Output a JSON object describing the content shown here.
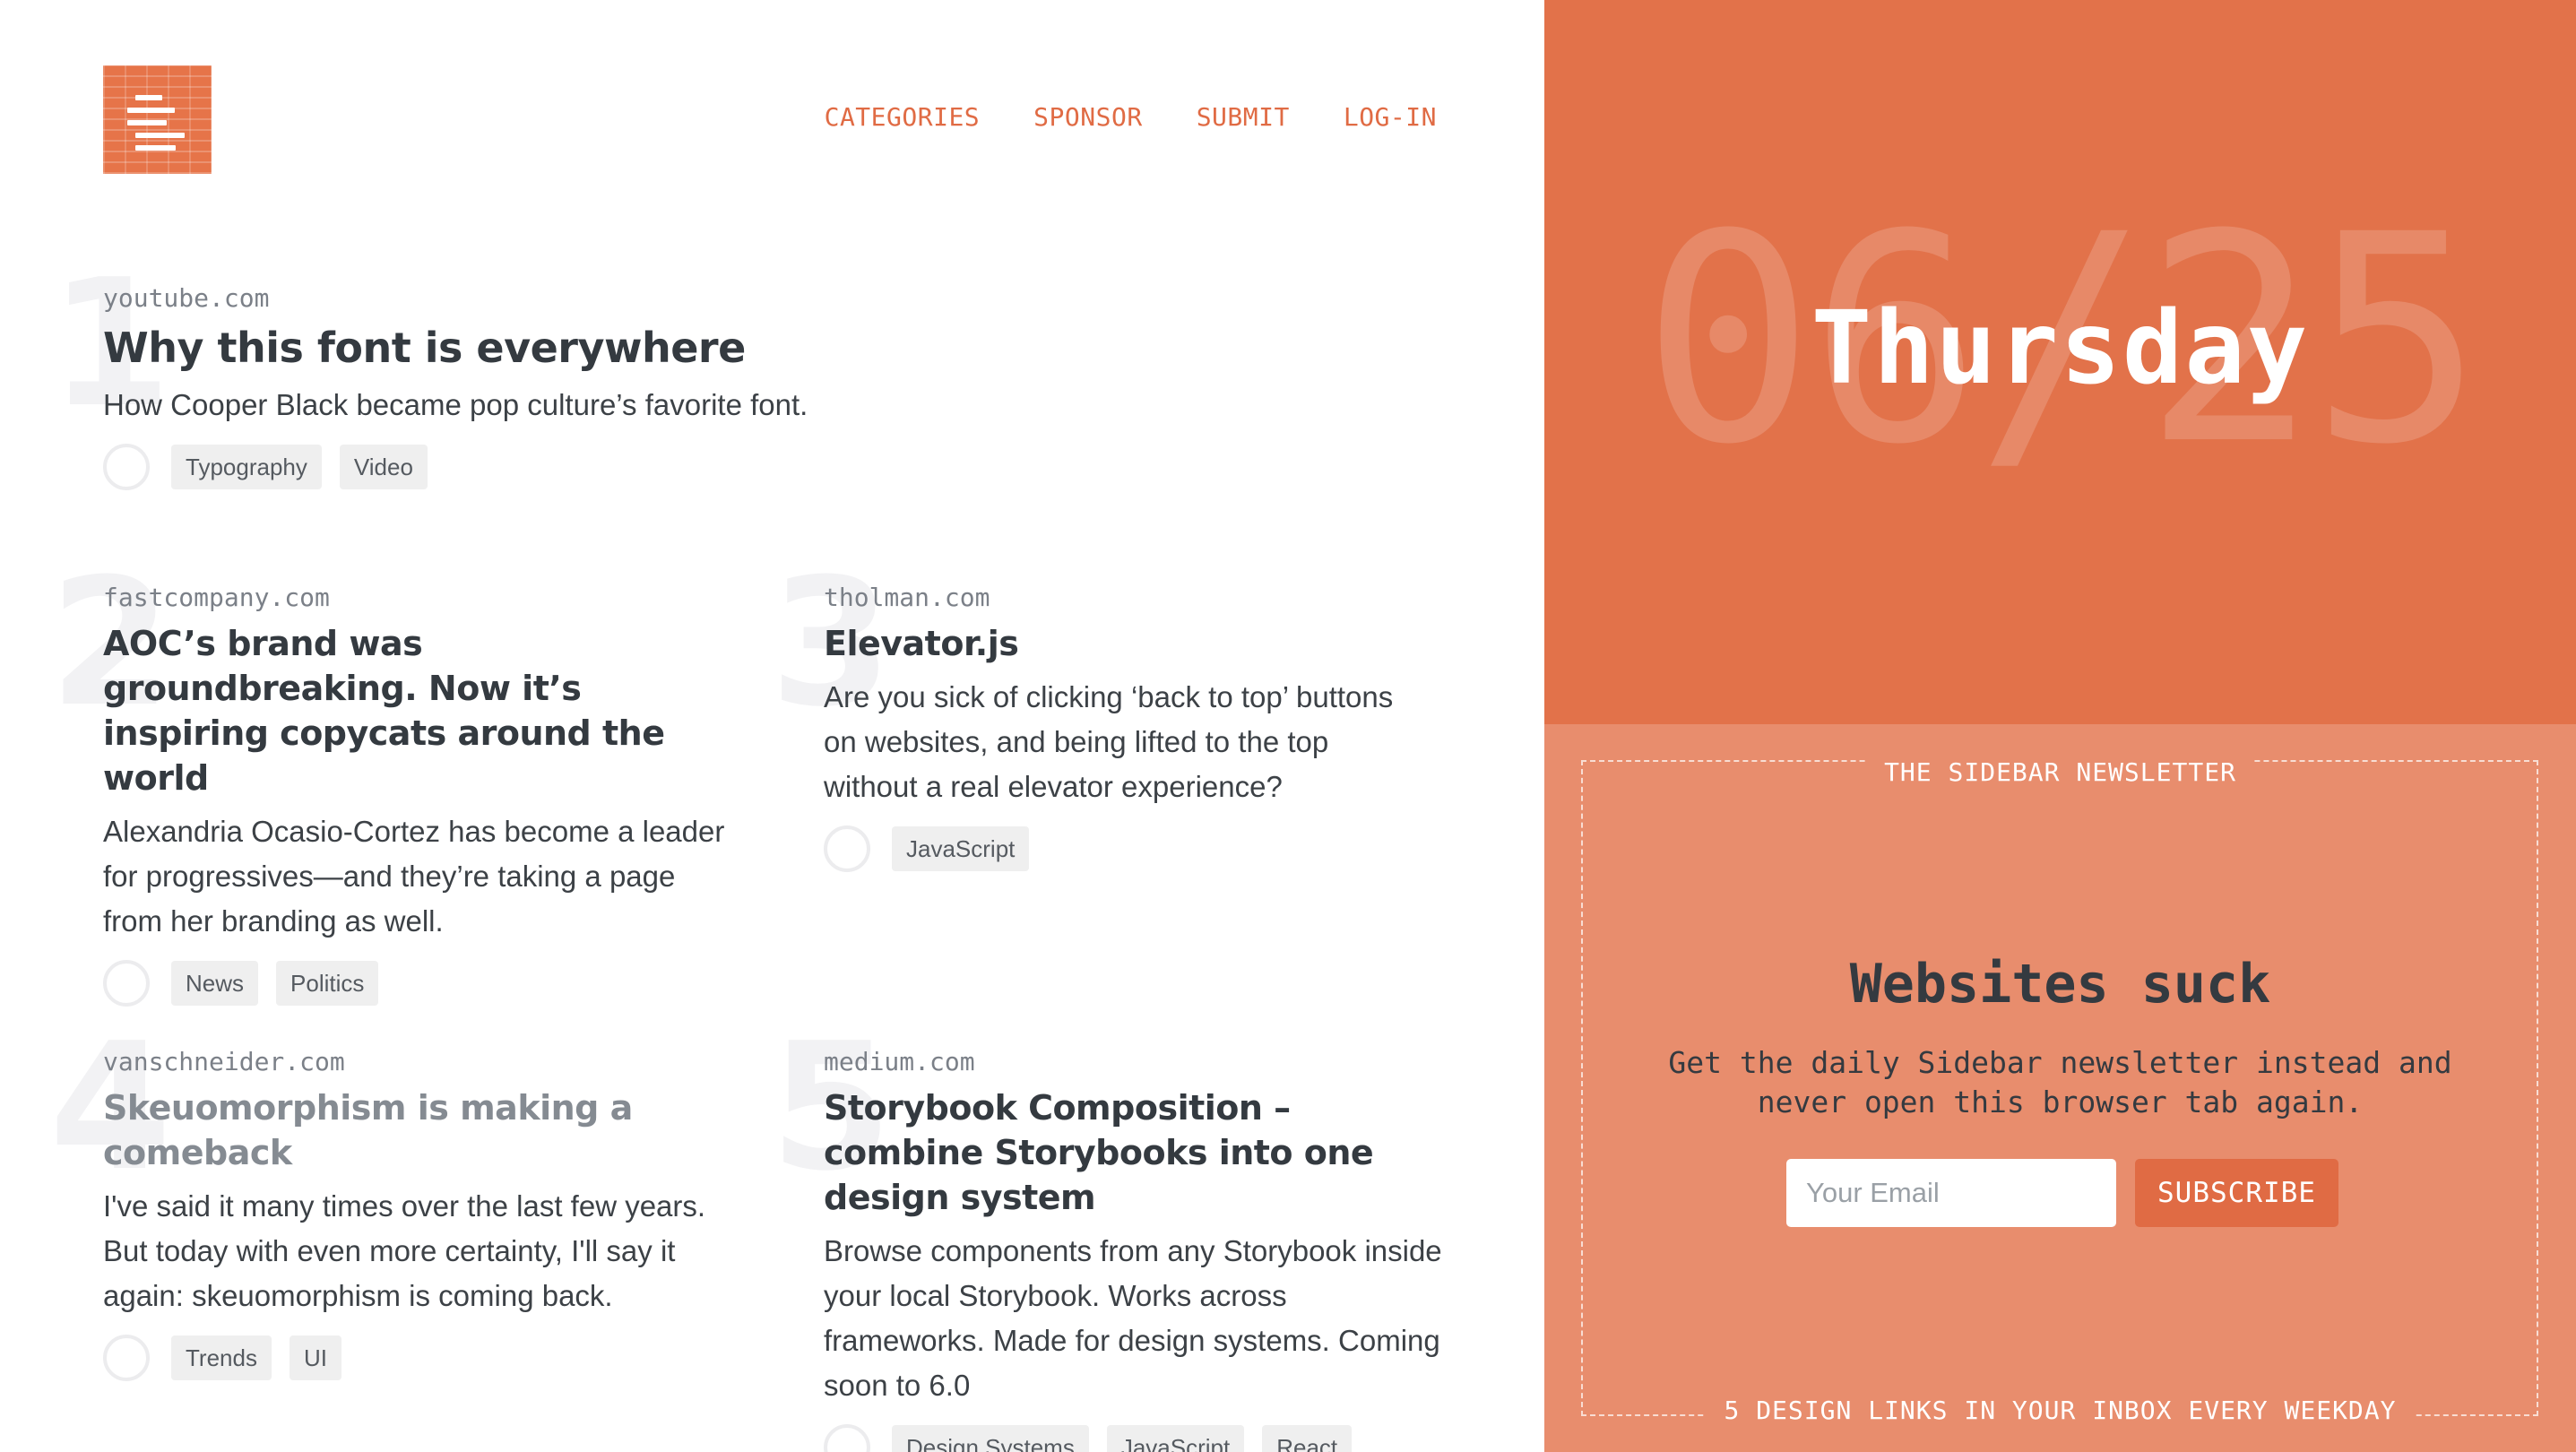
{
  "nav": {
    "items": [
      "CATEGORIES",
      "SPONSOR",
      "SUBMIT",
      "LOG-IN"
    ]
  },
  "articles": [
    {
      "number": "1",
      "domain": "youtube.com",
      "title": "Why this font is everywhere",
      "description": "How Cooper Black became pop culture’s favorite font.",
      "tags": [
        "Typography",
        "Video"
      ]
    },
    {
      "number": "2",
      "domain": "fastcompany.com",
      "title": "AOC’s brand was groundbreaking. Now it’s inspiring copycats around the world",
      "description": "Alexandria Ocasio-Cortez has become a leader for progressives—and they’re taking a page from her branding as well.",
      "tags": [
        "News",
        "Politics"
      ]
    },
    {
      "number": "3",
      "domain": "tholman.com",
      "title": "Elevator.js",
      "description": "Are you sick of clicking ‘back to top’ buttons on websites, and being lifted to the top without a real elevator experience?",
      "tags": [
        "JavaScript"
      ]
    },
    {
      "number": "4",
      "domain": "vanschneider.com",
      "title": "Skeuomorphism is making a comeback",
      "description": "I've said it many times over the last few years. But today with even more certainty, I'll say it again: skeuomorphism is coming back.",
      "tags": [
        "Trends",
        "UI"
      ]
    },
    {
      "number": "5",
      "domain": "medium.com",
      "title": "Storybook Composition – combine Storybooks into one design system",
      "description": "Browse components from any Storybook inside your local Storybook. Works across frameworks. Made for design systems. Coming soon to 6.0",
      "tags": [
        "Design Systems",
        "JavaScript",
        "React"
      ]
    }
  ],
  "date": {
    "background": "06/25",
    "day": "Thursday"
  },
  "newsletter": {
    "label": "THE SIDEBAR NEWSLETTER",
    "heading": "Websites suck",
    "body": "Get the daily Sidebar newsletter instead and never open this browser tab again.",
    "email_placeholder": "Your Email",
    "subscribe_label": "SUBSCRIBE",
    "footer": "5 DESIGN LINKS IN YOUR INBOX EVERY WEEKDAY"
  },
  "colors": {
    "accent": "#e06b44",
    "date_panel": "#e2724a",
    "newsletter_panel": "#e88d6d",
    "title_text": "#343a40",
    "visited_title": "#858b92"
  }
}
